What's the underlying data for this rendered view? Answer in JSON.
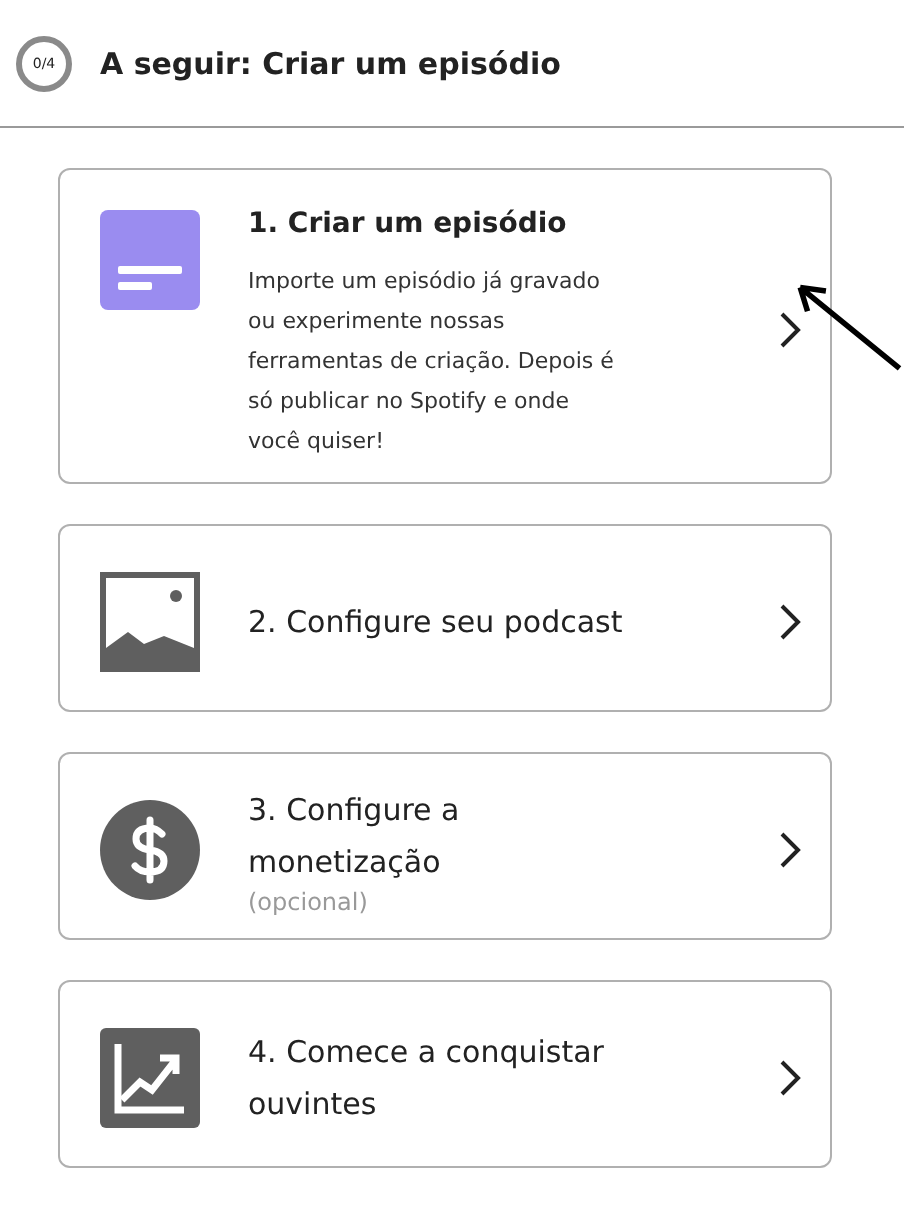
{
  "header": {
    "progress": "0/4",
    "title": "A seguir: Criar um episódio"
  },
  "steps": [
    {
      "kind": "document",
      "title": "1. Criar um episódio",
      "current": true,
      "description": "Importe um episódio já gravado ou experimente nossas ferramentas de criação. Depois é só publicar no Spotify e onde você quiser!"
    },
    {
      "kind": "image",
      "title": "2. Configure seu podcast",
      "current": false
    },
    {
      "kind": "dollar",
      "title": "3. Configure a monetização",
      "current": false,
      "note": "(opcional)"
    },
    {
      "kind": "chart",
      "title": "4. Comece a conquistar ouvintes",
      "current": false
    }
  ],
  "annotation": {
    "kind": "arrow"
  }
}
